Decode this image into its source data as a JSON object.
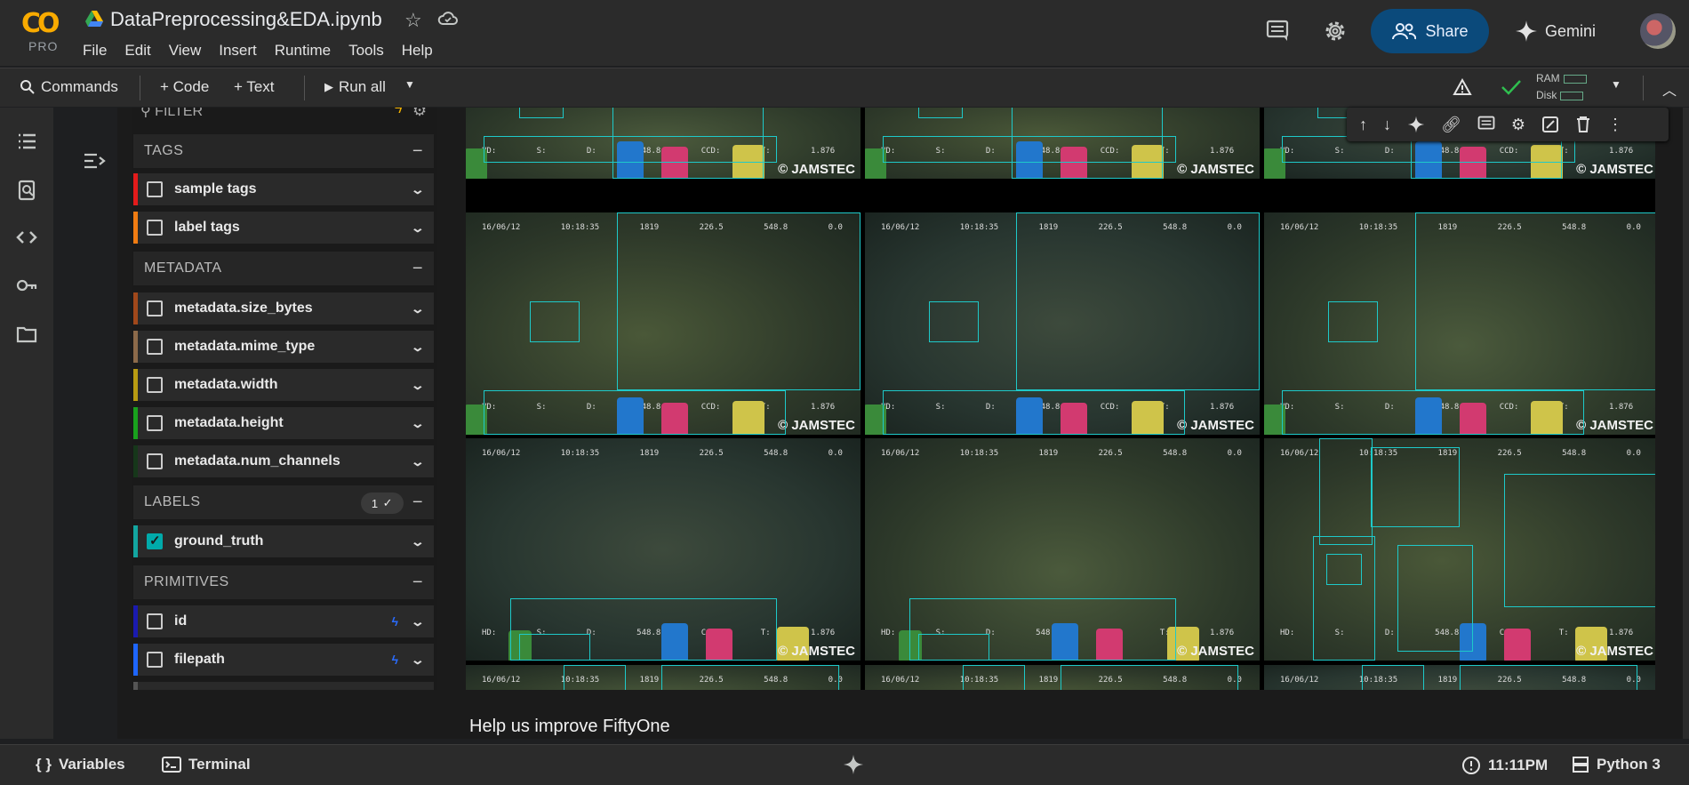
{
  "app": {
    "title": "DataPreprocessing&EDA.ipynb",
    "logo_text": "CO",
    "tier": "PRO"
  },
  "menu": [
    "File",
    "Edit",
    "View",
    "Insert",
    "Runtime",
    "Tools",
    "Help"
  ],
  "header": {
    "share_label": "Share",
    "gemini_label": "Gemini"
  },
  "toolbar": {
    "commands": "Commands",
    "code": "+ Code",
    "text": "+ Text",
    "run_all": "Run all",
    "ram": "RAM",
    "disk": "Disk"
  },
  "sidebar": {
    "filter_label": "FILTER",
    "sections": {
      "tags": "TAGS",
      "metadata": "METADATA",
      "labels": "LABELS",
      "primitives": "PRIMITIVES"
    },
    "tag_rows": [
      {
        "label": "sample tags",
        "color": "#e31b1b"
      },
      {
        "label": "label tags",
        "color": "#f07c12"
      }
    ],
    "metadata_rows": [
      {
        "label": "metadata.size_bytes",
        "color": "#a0481b"
      },
      {
        "label": "metadata.mime_type",
        "color": "#8c6a4a"
      },
      {
        "label": "metadata.width",
        "color": "#b89b12"
      },
      {
        "label": "metadata.height",
        "color": "#19a11d"
      },
      {
        "label": "metadata.num_channels",
        "color": "#16371a"
      }
    ],
    "labels_count": "1",
    "label_rows": [
      {
        "label": "ground_truth",
        "color": "#13a6a0",
        "checked": true
      }
    ],
    "primitive_rows": [
      {
        "label": "id",
        "color": "#1a1ab0"
      },
      {
        "label": "filepath",
        "color": "#1e66ff"
      }
    ]
  },
  "grid": {
    "watermark": "© JAMSTEC",
    "hud_top": [
      "16/06/12 10:18:35",
      "1819",
      "226.5",
      "548.8",
      "0.0"
    ],
    "hud_bottom": [
      "HD:",
      "S:",
      "D: 548.8",
      "CCD:",
      "T: 1.876"
    ]
  },
  "footer_text": "Help us improve FiftyOne",
  "statusbar": {
    "variables": "Variables",
    "terminal": "Terminal",
    "time": "11:11PM",
    "runtime": "Python 3"
  },
  "colors": {
    "accent": "#0b4a7b",
    "box": "#1ec9c9"
  }
}
